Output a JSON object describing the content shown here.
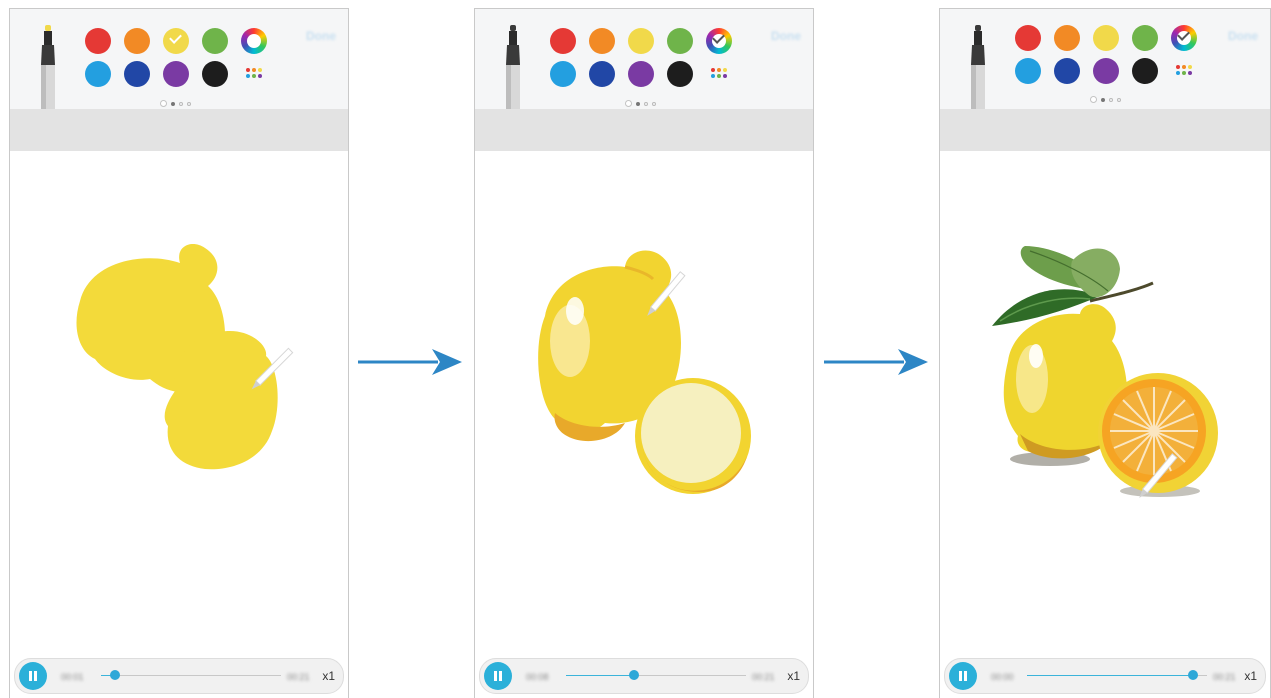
{
  "palette": {
    "row1": [
      {
        "name": "red",
        "hex": "#e53935"
      },
      {
        "name": "orange",
        "hex": "#f28a25"
      },
      {
        "name": "yellow",
        "hex": "#f1d94a"
      },
      {
        "name": "green",
        "hex": "#6fb44a"
      }
    ],
    "row2": [
      {
        "name": "light-blue",
        "hex": "#239fe0"
      },
      {
        "name": "dark-blue",
        "hex": "#2147a6"
      },
      {
        "name": "purple",
        "hex": "#7a3aa3"
      },
      {
        "name": "black",
        "hex": "#1d1d1d"
      }
    ],
    "selected_color": "yellow",
    "icons": [
      "color-wheel-icon",
      "more-colors-icon",
      "marker-pen-icon",
      "history-icon"
    ]
  },
  "toolbar": {
    "done_label": "Done"
  },
  "panels": [
    {
      "progress": 0.08,
      "speed_label": "x1",
      "start_time": "00:01",
      "end_time": "00:21"
    },
    {
      "progress": 0.38,
      "speed_label": "x1",
      "start_time": "00:08",
      "end_time": "00:21"
    },
    {
      "progress": 0.92,
      "speed_label": "x1",
      "start_time": "00:00",
      "end_time": "00:21"
    }
  ],
  "colors": {
    "accent": "#2bb0d9",
    "arrow": "#2d86c5",
    "lemon": "#f3da3a"
  }
}
